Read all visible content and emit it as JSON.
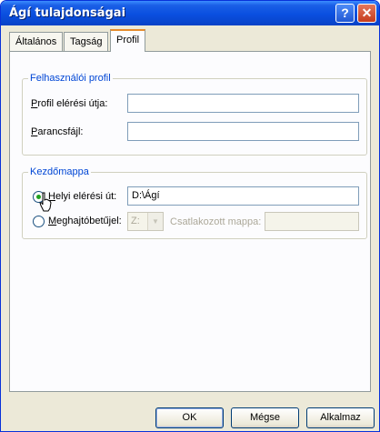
{
  "window": {
    "title": "Ágí tulajdonságai",
    "help_glyph": "?",
    "close_glyph": "✕"
  },
  "tabs": [
    "Általános",
    "Tagság",
    "Profil"
  ],
  "active_tab": "Profil",
  "profile_group": {
    "legend": "Felhasználói profil",
    "path_label_u": "P",
    "path_label_rest": "rofil elérési útja:",
    "path_value": "",
    "script_label_u": "P",
    "script_label_rest": "arancsfájl:",
    "script_value": ""
  },
  "home_group": {
    "legend": "Kezdőmappa",
    "local_label_u": "H",
    "local_label_rest": "elyi elérési út:",
    "local_value": "D:\\Ágí",
    "local_checked": true,
    "drive_label_u": "M",
    "drive_label_rest": "eghajtóbetűjel:",
    "drive_value": "Z:",
    "connect_label": "Csatlakozott mappa:",
    "connect_value": ""
  },
  "buttons": {
    "ok": "OK",
    "cancel": "Mégse",
    "apply": "Alkalmaz"
  },
  "colors": {
    "titlebar": "#0a4fe0",
    "legend": "#0046d5",
    "tab_highlight": "#e68b2c",
    "dialog_bg": "#ece9d8"
  }
}
